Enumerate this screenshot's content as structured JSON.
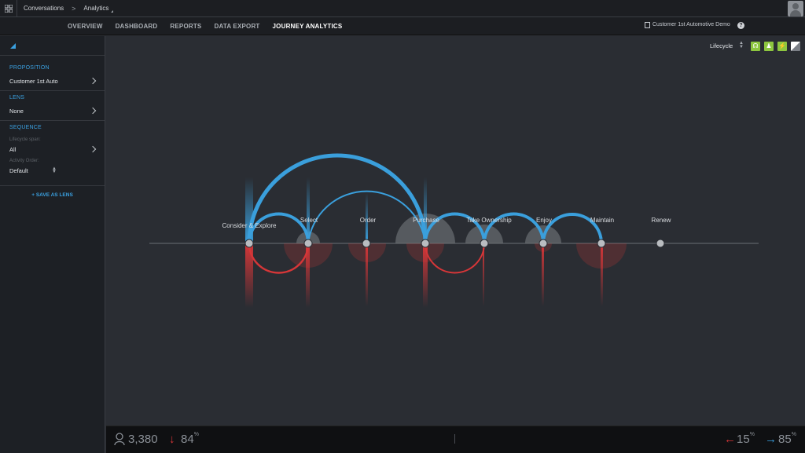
{
  "breadcrumb": {
    "root": "Conversations",
    "separator": ">",
    "current": "Analytics"
  },
  "nav": {
    "tabs": [
      {
        "label": "OVERVIEW",
        "active": false
      },
      {
        "label": "DASHBOARD",
        "active": false
      },
      {
        "label": "REPORTS",
        "active": false
      },
      {
        "label": "DATA EXPORT",
        "active": false
      },
      {
        "label": "JOURNEY ANALYTICS",
        "active": true
      }
    ],
    "account": "Customer 1st Automotive Demo",
    "help": "?"
  },
  "sidebar": {
    "proposition_heading": "PROPOSITION",
    "proposition_value": "Customer 1st Auto",
    "lens_heading": "LENS",
    "lens_value": "None",
    "sequence_heading": "SEQUENCE",
    "lifecycle_span_label": "Lifecycle span:",
    "lifecycle_span_value": "All",
    "activity_order_label": "Activity Order:",
    "activity_order_value": "Default",
    "save_lens": "+ SAVE AS LENS"
  },
  "toolbar": {
    "view_label": "Lifecycle",
    "filter_icons": [
      "headset-icon",
      "person-icon",
      "lightning-icon",
      "contrast-icon"
    ]
  },
  "journey": {
    "stages": [
      "Consider & Explore",
      "Select",
      "Order",
      "Purchase",
      "Take Ownership",
      "Enjoy",
      "Maintain",
      "Renew"
    ],
    "colors": {
      "forward": "#3a9fdc",
      "backward": "#d63638",
      "node": "#b9bcc0"
    }
  },
  "footer": {
    "users": "3,380",
    "drop_pct": "84",
    "backward_pct": "15",
    "forward_pct": "85",
    "pct_symbol": "%"
  }
}
